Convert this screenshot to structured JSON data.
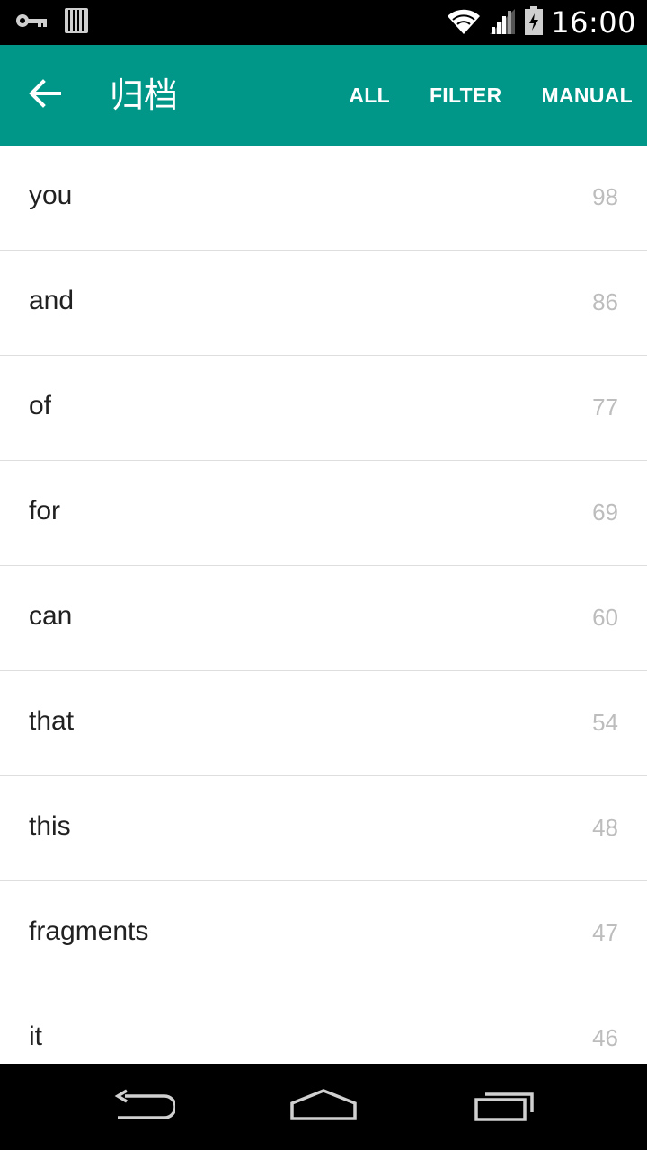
{
  "status_bar": {
    "time": "16:00",
    "icons": [
      "key-icon",
      "barcode-icon",
      "wifi-icon",
      "signal-icon",
      "battery-icon"
    ]
  },
  "app_bar": {
    "title": "归档",
    "back_icon": "arrow-back-icon",
    "actions": [
      "ALL",
      "FILTER",
      "MANUAL"
    ],
    "color": "#009688"
  },
  "list": {
    "items": [
      {
        "word": "you",
        "count": "98"
      },
      {
        "word": "and",
        "count": "86"
      },
      {
        "word": "of",
        "count": "77"
      },
      {
        "word": "for",
        "count": "69"
      },
      {
        "word": "can",
        "count": "60"
      },
      {
        "word": "that",
        "count": "54"
      },
      {
        "word": "this",
        "count": "48"
      },
      {
        "word": "fragments",
        "count": "47"
      },
      {
        "word": "it",
        "count": "46"
      }
    ]
  },
  "nav_bar": {
    "buttons": [
      "back-icon",
      "home-icon",
      "recent-apps-icon"
    ]
  }
}
